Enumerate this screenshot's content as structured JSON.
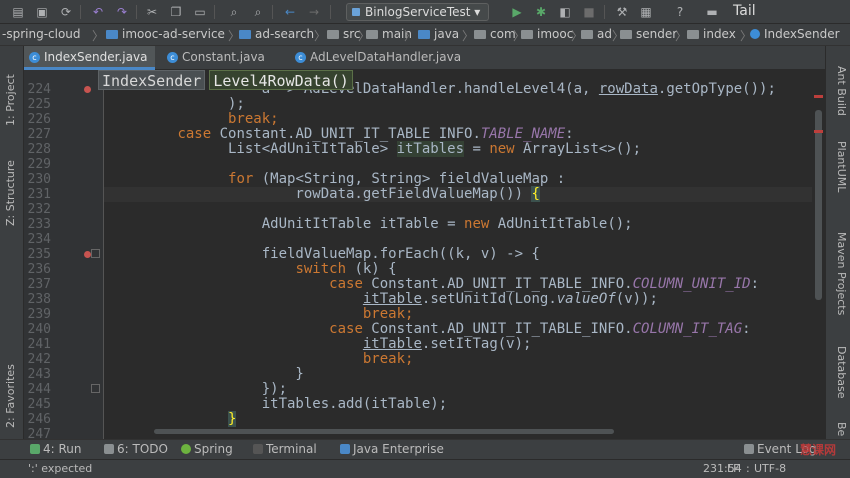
{
  "toolbar": {
    "run_config": "BinlogServiceTest",
    "tail_label": "Tail"
  },
  "breadcrumbs": [
    "-spring-cloud",
    "imooc-ad-service",
    "ad-search",
    "src",
    "main",
    "java",
    "com",
    "imooc",
    "ad",
    "sender",
    "index",
    "IndexSender"
  ],
  "tabs": [
    {
      "label": "IndexSender.java",
      "active": true
    },
    {
      "label": "Constant.java",
      "active": false
    },
    {
      "label": "AdLevelDataHandler.java",
      "active": false
    }
  ],
  "hints": {
    "class": "IndexSender",
    "method": "Level4RowData()"
  },
  "left_tools": {
    "project": "1: Project",
    "structure": "Z: Structure",
    "favorites": "2: Favorites"
  },
  "right_tools": {
    "ant": "Ant Build",
    "plantuml": "PlantUML",
    "maven": "Maven Projects",
    "database": "Database",
    "bean": "Be"
  },
  "line_numbers": [
    "224",
    "225",
    "226",
    "227",
    "228",
    "229",
    "230",
    "231",
    "232",
    "233",
    "234",
    "235",
    "236",
    "237",
    "238",
    "239",
    "240",
    "241",
    "242",
    "243",
    "244",
    "245",
    "246",
    "247"
  ],
  "code": {
    "l224a": "                  a -> AdLevelDataHandler.handleLevel4(a, ",
    "l224b": "rowData",
    "l224c": ".getOpType());",
    "l225": "              );",
    "l226": "              break;",
    "l227kw": "case",
    "l227a": " Constant.AD_UNIT_IT_TABLE_INFO.",
    "l227f": "TABLE_NAME",
    "l227b": ":",
    "l228a": "              List<AdUnitItTable> ",
    "l228v": "itTables",
    "l228b": " = ",
    "l228kw": "new",
    "l228c": " ArrayList<>();",
    "l230kw": "for",
    "l230a": " (Map<String, String> fieldValueMap :",
    "l231a": "                      rowData.getFieldValueMap()) ",
    "l231b": "{",
    "l233a": "                  AdUnitItTable itTable = ",
    "l233kw": "new",
    "l233b": " AdUnitItTable();",
    "l235": "                  fieldValueMap.forEach((k, v) -> {",
    "l236kw": "switch",
    "l236a": " (k) {",
    "l237kw": "case",
    "l237a": " Constant.AD_UNIT_IT_TABLE_INFO.",
    "l237f": "COLUMN_UNIT_ID",
    "l237b": ":",
    "l238v": "itTable",
    "l238a": ".setUnitId(Long.",
    "l238s": "valueOf",
    "l238b": "(v));",
    "l239kw": "break;",
    "l240kw": "case",
    "l240a": " Constant.AD_UNIT_IT_TABLE_INFO.",
    "l240f": "COLUMN_IT_TAG",
    "l240b": ":",
    "l241v": "itTable",
    "l241a": ".setItTag(v);",
    "l242kw": "break;",
    "l243": "                      }",
    "l244": "                  });",
    "l245": "                  itTables.add(itTable);",
    "l246": "}"
  },
  "bottom_tools": {
    "run": "4: Run",
    "todo": "6: TODO",
    "spring": "Spring",
    "terminal": "Terminal",
    "java_ee": "Java Enterprise",
    "event_log": "Event Log"
  },
  "status": {
    "message": "':' expected",
    "position": "231:54",
    "line_sep": "LF",
    "encoding": "UTF-8"
  },
  "watermark": "慧课网",
  "colors": {
    "keyword": "#cc7832",
    "field": "#9876aa",
    "text": "#a9b7c6",
    "accent": "#4a88c7"
  }
}
